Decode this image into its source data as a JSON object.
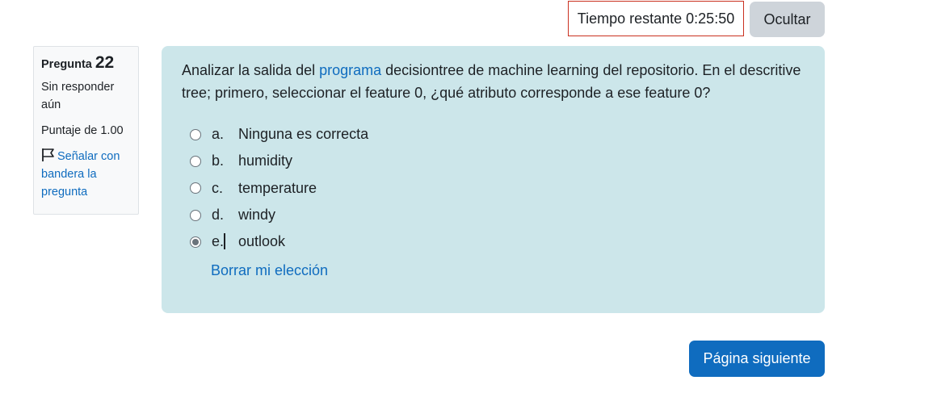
{
  "timer": {
    "text": "Tiempo restante 0:25:50"
  },
  "hide_button": {
    "label": "Ocultar"
  },
  "question_info": {
    "label": "Pregunta",
    "number": "22",
    "state": "Sin responder aún",
    "grade": "Puntaje de 1.00",
    "flag_label": "Señalar con bandera la pregunta"
  },
  "question": {
    "text_before": "Analizar la salida del ",
    "link_text": "programa",
    "text_after": " decisiontree de machine learning del repositorio. En el descritive tree; primero, seleccionar el feature 0, ¿qué atributo corresponde a ese feature 0?",
    "options": [
      {
        "letter": "a.",
        "text": "Ninguna es correcta",
        "selected": false
      },
      {
        "letter": "b.",
        "text": "humidity",
        "selected": false
      },
      {
        "letter": "c.",
        "text": "temperature",
        "selected": false
      },
      {
        "letter": "d.",
        "text": "windy",
        "selected": false
      },
      {
        "letter": "e.",
        "text": "outlook",
        "selected": true
      }
    ],
    "clear_choice": "Borrar mi elección"
  },
  "next_button": {
    "label": "Página siguiente"
  },
  "colors": {
    "accent": "#0f6cbf",
    "content_bg": "#cce6ea",
    "timer_border": "#ca3120"
  }
}
